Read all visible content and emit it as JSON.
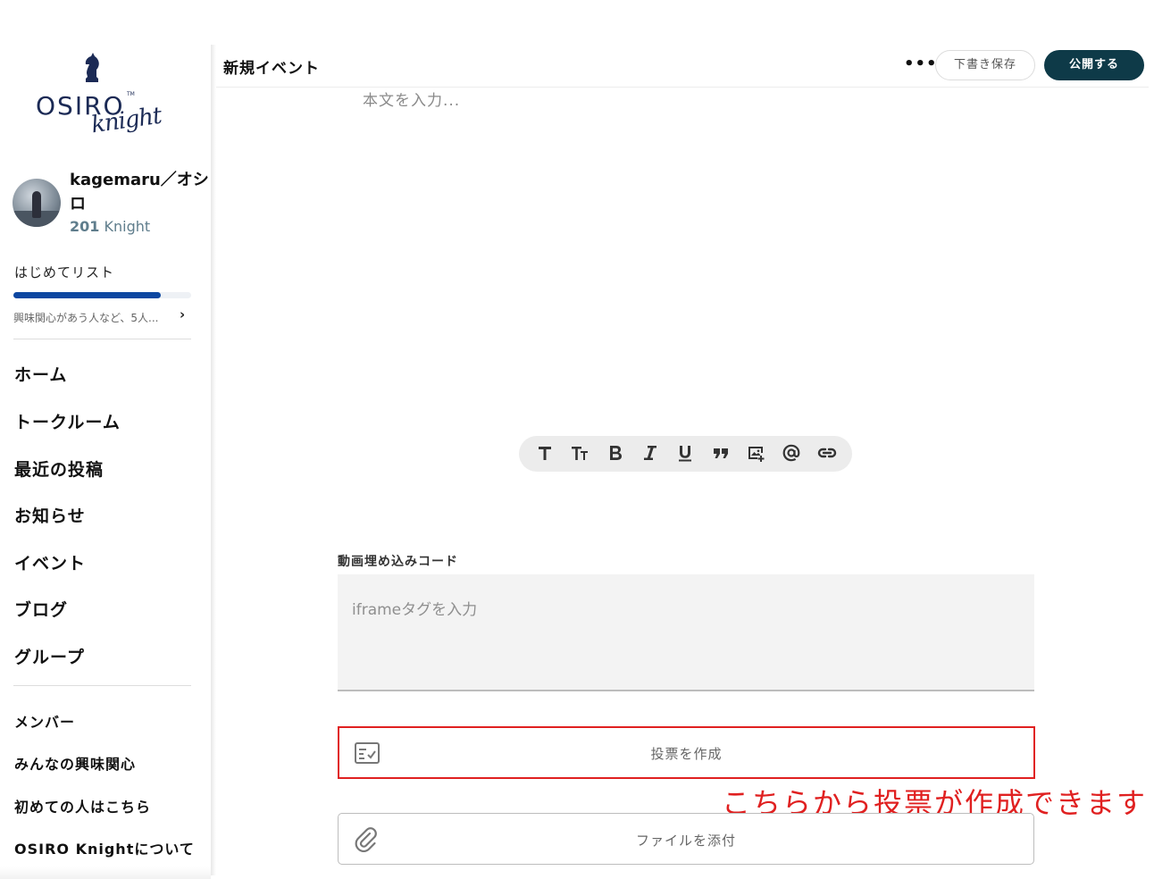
{
  "brand": {
    "name": "OSIRO",
    "tm": "TM",
    "script": "knight",
    "color": "#1b2a55"
  },
  "profile": {
    "name": "kagemaru／オシロ",
    "points_value": "201",
    "points_unit": "Knight"
  },
  "checklist": {
    "title": "はじめてリスト",
    "progress": 0.83,
    "hint": "興味関心があう人など、5人...",
    "chevron": "›"
  },
  "nav": {
    "items": [
      "ホーム",
      "トークルーム",
      "最近の投稿",
      "お知らせ",
      "イベント",
      "ブログ",
      "グループ"
    ]
  },
  "subnav": {
    "items": [
      "メンバー",
      "みんなの興味関心",
      "初めての人はこちら",
      "OSIRO Knightについて"
    ]
  },
  "header": {
    "title": "新規イベント",
    "more": "•••",
    "draft_label": "下書き保存",
    "publish_label": "公開する"
  },
  "editor": {
    "body_placeholder": "本文を入力...",
    "toolbar_icons": [
      "text-icon",
      "text-size-icon",
      "bold-icon",
      "italic-icon",
      "underline-icon",
      "quote-icon",
      "insert-image-icon",
      "mention-icon",
      "link-icon"
    ]
  },
  "embed": {
    "label": "動画埋め込みコード",
    "placeholder": "iframeタグを入力"
  },
  "poll": {
    "label": "投票を作成",
    "icon": "poll-icon"
  },
  "annotation": {
    "text": "こちらから投票が作成できます",
    "color": "#e02020"
  },
  "attach": {
    "label": "ファイルを添付",
    "icon": "paperclip-icon"
  },
  "colors": {
    "accent": "#0e3a48",
    "progress": "#0d47a1"
  }
}
